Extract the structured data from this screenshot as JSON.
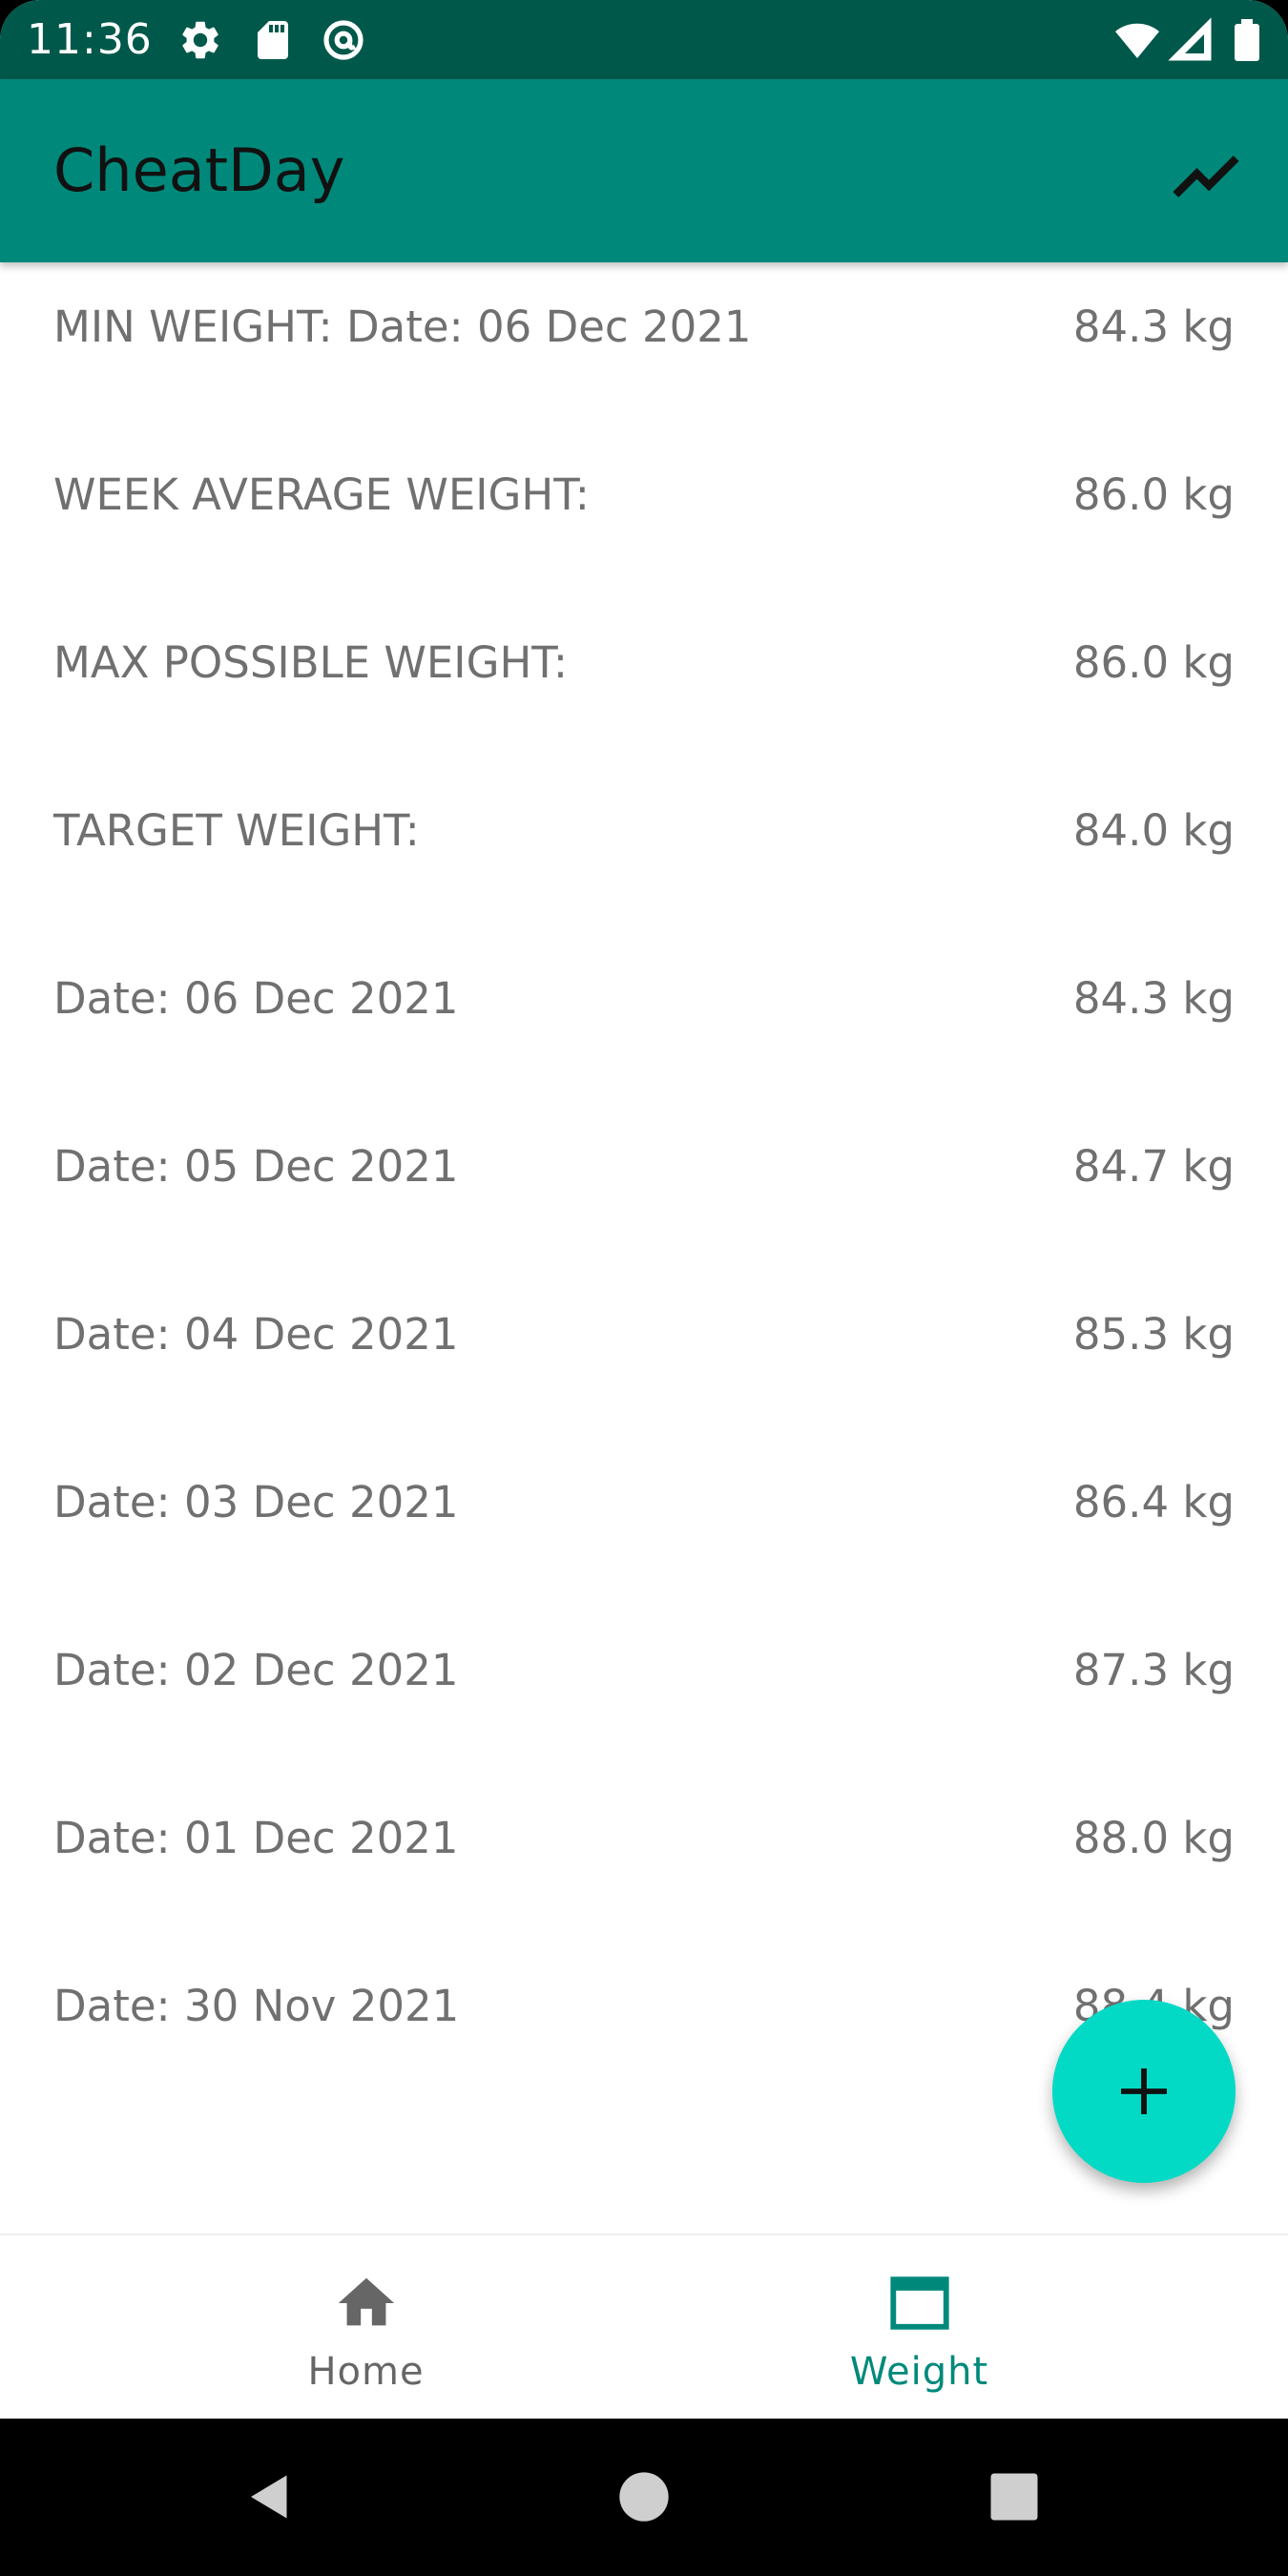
{
  "status_bar": {
    "time": "11:36",
    "icons": [
      "settings-icon",
      "sd-card-icon",
      "at-sign-icon",
      "wifi-icon",
      "signal-icon",
      "battery-icon"
    ]
  },
  "app_bar": {
    "title": "CheatDay",
    "action_icon": "trending-chart-icon"
  },
  "colors": {
    "status_bar": "#00584a",
    "app_bar": "#00897b",
    "fab": "#03dac5",
    "accent": "#00897b",
    "text_secondary": "#707070"
  },
  "weights": [
    {
      "label": "MIN WEIGHT: Date: 06 Dec 2021",
      "value": "84.3 kg"
    },
    {
      "label": "WEEK AVERAGE WEIGHT:",
      "value": "86.0 kg"
    },
    {
      "label": "MAX POSSIBLE WEIGHT:",
      "value": "86.0 kg"
    },
    {
      "label": "TARGET WEIGHT:",
      "value": "84.0 kg"
    },
    {
      "label": "Date: 06 Dec 2021",
      "value": "84.3 kg"
    },
    {
      "label": "Date: 05 Dec 2021",
      "value": "84.7 kg"
    },
    {
      "label": "Date: 04 Dec 2021",
      "value": "85.3 kg"
    },
    {
      "label": "Date: 03 Dec 2021",
      "value": "86.4 kg"
    },
    {
      "label": "Date: 02 Dec 2021",
      "value": "87.3 kg"
    },
    {
      "label": "Date: 01 Dec 2021",
      "value": "88.0 kg"
    },
    {
      "label": "Date: 30 Nov 2021",
      "value": "88.4 kg"
    }
  ],
  "fab": {
    "icon": "plus-icon"
  },
  "bottom_nav": {
    "items": [
      {
        "label": "Home",
        "icon": "home-icon",
        "selected": false
      },
      {
        "label": "Weight",
        "icon": "weight-tab-icon",
        "selected": true
      }
    ]
  },
  "system_nav": {
    "icons": [
      "back-icon",
      "home-circle-icon",
      "recents-icon"
    ]
  }
}
